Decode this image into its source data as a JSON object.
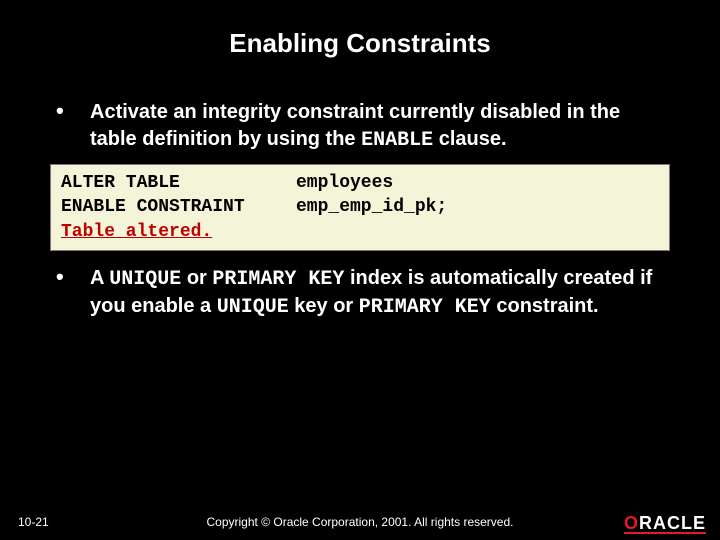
{
  "title": "Enabling Constraints",
  "bullets": [
    {
      "pre": "Activate an integrity constraint currently disabled in the table definition by using the ",
      "code1": "ENABLE",
      "post": " clause."
    },
    {
      "pre": "A ",
      "code1": "UNIQUE",
      "mid1": " or ",
      "code2": "PRIMARY KEY",
      "mid2": " index is automatically created if you enable a ",
      "code3": "UNIQUE",
      "mid3": " key or ",
      "code4": "PRIMARY KEY",
      "post": " constraint."
    }
  ],
  "code": {
    "line1_col1": "ALTER TABLE",
    "line1_col2": "employees",
    "line2_col1": "ENABLE CONSTRAINT",
    "line2_col2": "emp_emp_id_pk;",
    "result": "Table altered."
  },
  "footer": {
    "page": "10-21",
    "copyright": "Copyright © Oracle Corporation, 2001. All rights reserved.",
    "logo_o": "O",
    "logo_rest": "RACLE"
  }
}
